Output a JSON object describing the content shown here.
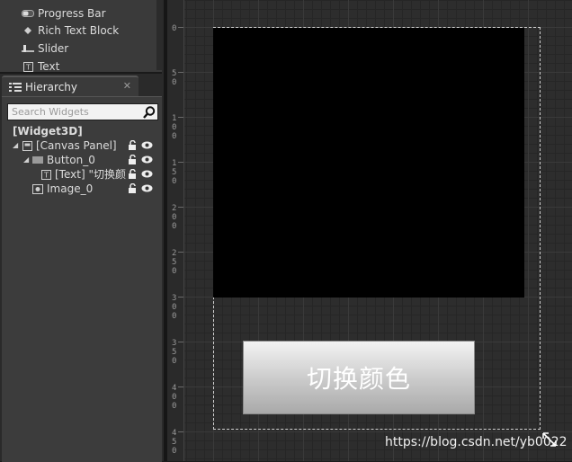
{
  "palette": {
    "items": [
      {
        "label": "Progress Bar",
        "icon": "progress-bar-icon"
      },
      {
        "label": "Rich Text Block",
        "icon": "rich-text-icon"
      },
      {
        "label": "Slider",
        "icon": "slider-icon"
      },
      {
        "label": "Text",
        "icon": "text-icon"
      }
    ]
  },
  "hierarchy": {
    "tab_label": "Hierarchy",
    "search_placeholder": "Search Widgets",
    "tree": [
      {
        "label": "[Widget3D]",
        "bold": true
      },
      {
        "label": "[Canvas Panel]",
        "icon": "canvas-panel-icon"
      },
      {
        "label": "Button_0",
        "icon": "button-widget-icon"
      },
      {
        "label": "[Text] \"切换颜色",
        "icon": "text-widget-icon"
      },
      {
        "label": "Image_0",
        "icon": "image-widget-icon"
      }
    ]
  },
  "ruler": {
    "labels": [
      "0",
      "50",
      "100",
      "150",
      "200",
      "250",
      "300",
      "350",
      "400",
      "450"
    ]
  },
  "designer": {
    "button_text": "切换颜色",
    "image_color": "#000000"
  },
  "watermark": "https://blog.csdn.net/yb0022",
  "colors": {
    "panel_bg": "#3c3c3c",
    "viewport_bg": "#2d2d2d",
    "accent": "#ffffff"
  }
}
